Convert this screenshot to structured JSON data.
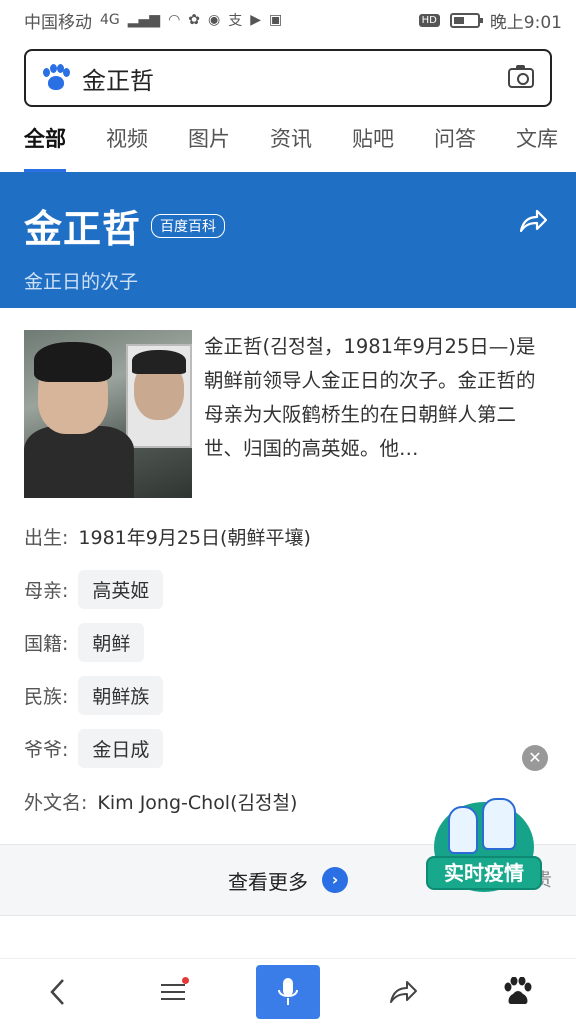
{
  "status_bar": {
    "carrier": "中国移动",
    "network": "4G",
    "hd": "HD",
    "time": "晚上9:01"
  },
  "search": {
    "query": "金正哲"
  },
  "tabs": [
    {
      "label": "全部",
      "active": true
    },
    {
      "label": "视频"
    },
    {
      "label": "图片"
    },
    {
      "label": "资讯"
    },
    {
      "label": "贴吧"
    },
    {
      "label": "问答"
    },
    {
      "label": "文库"
    }
  ],
  "hero": {
    "name": "金正哲",
    "badge": "百度百科",
    "subtitle": "金正日的次子"
  },
  "intro": {
    "text": "金正哲(김정철，1981年9月25日—)是朝鲜前领导人金正日的次子。金正哲的母亲为大阪鹤桥生的在日朝鲜人第二世、归国的高英姬。他…"
  },
  "info": {
    "birth_label": "出生:",
    "birth_value": "1981年9月25日(朝鲜平壤)",
    "mother_label": "母亲:",
    "mother_value": "高英姬",
    "nationality_label": "国籍:",
    "nationality_value": "朝鲜",
    "ethnicity_label": "民族:",
    "ethnicity_value": "朝鲜族",
    "grandfather_label": "爷爷:",
    "grandfather_value": "金日成",
    "foreign_name_label": "外文名:",
    "foreign_name_value": "Kim Jong-Chol(김정철)"
  },
  "more": {
    "label": "查看更多",
    "cut_text": "贵"
  },
  "epidemic": {
    "label": "实时疫情"
  },
  "colors": {
    "accent": "#2a6fe3",
    "hero_bg": "#1f6fc5",
    "epidemic_green": "#16a38a"
  }
}
